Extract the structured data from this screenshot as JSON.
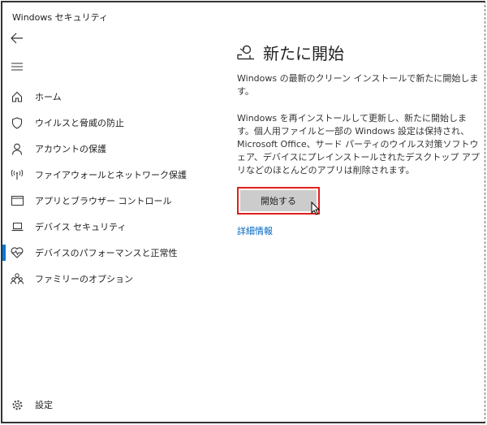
{
  "window": {
    "title": "Windows セキュリティ"
  },
  "sidebar": {
    "items": [
      {
        "label": "ホーム",
        "icon": "home-icon"
      },
      {
        "label": "ウイルスと脅威の防止",
        "icon": "shield-icon"
      },
      {
        "label": "アカウントの保護",
        "icon": "person-icon"
      },
      {
        "label": "ファイアウォールとネットワーク保護",
        "icon": "wireless-icon"
      },
      {
        "label": "アプリとブラウザー コントロール",
        "icon": "app-window-icon"
      },
      {
        "label": "デバイス セキュリティ",
        "icon": "laptop-icon"
      },
      {
        "label": "デバイスのパフォーマンスと正常性",
        "icon": "heart-icon",
        "active": true
      },
      {
        "label": "ファミリーのオプション",
        "icon": "family-icon"
      }
    ],
    "settings": {
      "label": "設定",
      "icon": "gear-icon"
    }
  },
  "main": {
    "title": "新たに開始",
    "subtitle": "Windows の最新のクリーン インストールで新たに開始します。",
    "description": "Windows を再インストールして更新し、新たに開始します。個人用ファイルと一部の Windows 設定は保持され、Microsoft Office、サード パーティのウイルス対策ソフトウェア、デバイスにプレインストールされたデスクトップ アプリなどのほとんどのアプリは削除されます。",
    "start_button": "開始する",
    "more_info_link": "詳細情報"
  },
  "colors": {
    "accent": "#0078d7",
    "highlight": "#e0201e",
    "link": "#0067c0"
  }
}
